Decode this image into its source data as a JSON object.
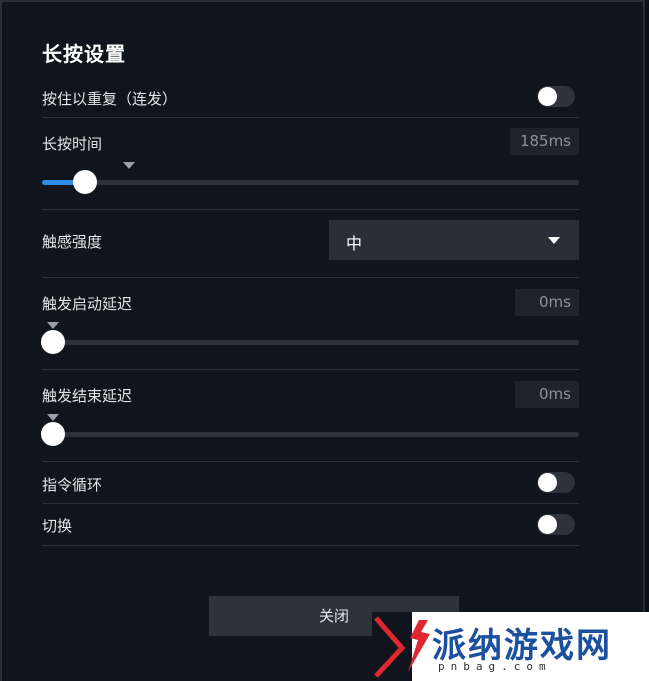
{
  "title": "长按设置",
  "repeat": {
    "label": "按住以重复（连发）",
    "on": false
  },
  "press_time": {
    "label": "长按时间",
    "value_text": "185ms",
    "fraction": 0.08
  },
  "vibration": {
    "label": "触感强度",
    "selected": "中"
  },
  "trigger_start": {
    "label": "触发启动延迟",
    "value_text": "0ms",
    "fraction": 0.0
  },
  "trigger_end": {
    "label": "触发结束延迟",
    "value_text": "0ms",
    "fraction": 0.0
  },
  "loop": {
    "label": "指令循环",
    "on": false
  },
  "switch": {
    "label": "切换",
    "on": false
  },
  "close_label": "关闭",
  "watermark": {
    "text": "派纳游戏网",
    "sub": "pnbag.com"
  },
  "colors": {
    "accent": "#2e8be6",
    "background": "#10151d",
    "button": "#2e333b"
  }
}
